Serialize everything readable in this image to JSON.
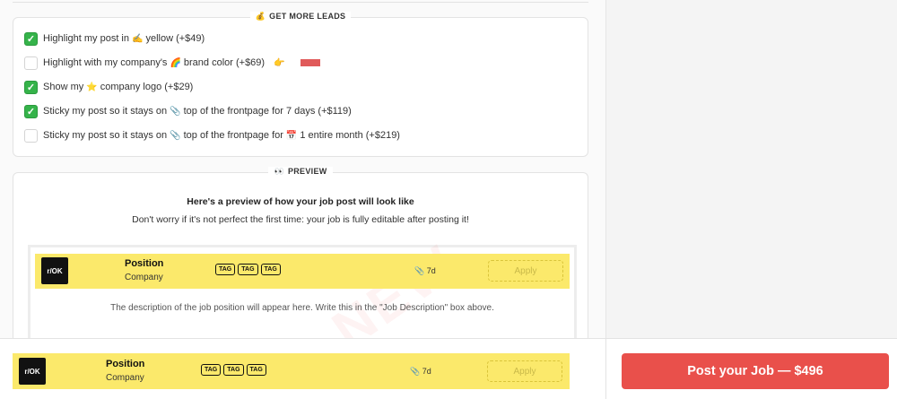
{
  "leads": {
    "title": "GET MORE LEADS",
    "title_icon": "moneybag-icon",
    "options": [
      {
        "checked": true,
        "prefix": "Highlight my post in",
        "emoji": "✍",
        "suffix": "yellow (+$49)"
      },
      {
        "checked": false,
        "prefix": "Highlight with my company's",
        "emoji": "🌈",
        "suffix": "brand color (+$69)",
        "pointer": "👉",
        "swatch_color": "#e05a5a"
      },
      {
        "checked": true,
        "prefix": "Show my",
        "emoji": "⭐",
        "suffix": "company logo (+$29)"
      },
      {
        "checked": true,
        "prefix": "Sticky my post so it stays on",
        "emoji": "📎",
        "suffix": "top of the frontpage for 7 days (+$119)"
      },
      {
        "checked": false,
        "prefix": "Sticky my post so it stays on",
        "emoji": "📎",
        "middle": "top of the frontpage for",
        "emoji2": "📅",
        "suffix": "1 entire month (+$219)"
      }
    ]
  },
  "preview": {
    "title": "PREVIEW",
    "title_icon": "eyes-icon",
    "heading": "Here's a preview of how your job post will look like",
    "subheading": "Don't worry if it's not perfect the first time: your job is fully editable after posting it!",
    "description": "The description of the job position will appear here. Write this in the \"Job Description\" box above.",
    "watermark": "NEW"
  },
  "job": {
    "logo_text": "r/OK",
    "position": "Position",
    "company": "Company",
    "tags": [
      "TAG",
      "TAG",
      "TAG"
    ],
    "age_icon": "paperclip-icon",
    "age": "7d",
    "apply": "Apply",
    "highlight_color": "#fbe96b"
  },
  "post_button": {
    "label": "Post your Job — $496",
    "color": "#e9504b"
  }
}
